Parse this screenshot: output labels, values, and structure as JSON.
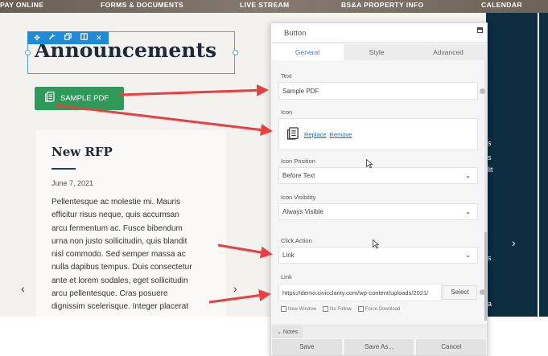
{
  "site": {
    "nav": [
      "PAY ONLINE",
      "FORMS & DOCUMENTS",
      "LIVE STREAM",
      "BS&A PROPERTY INFO",
      "CALENDAR"
    ],
    "toolbar_icons": [
      "move-icon",
      "wrench-icon",
      "copy-icon",
      "columns-icon",
      "close-icon"
    ],
    "heading": "Announcements",
    "pdf_button_label": "SAMPLE PDF",
    "card": {
      "title": "New RFP",
      "date": "June 7, 2021",
      "body_lines": [
        "Pellentesque ac molestie mi. Mauris",
        "efficitur risus neque, quis accumsan",
        "arcu fermentum ac. Fusce bibendum",
        "urna non justo sollicitudin, quis blandit",
        "nisl commodo. Sed semper massa ac",
        "nulla dapibus tempus. Duis consectetur",
        "ante et lorem sodales, eget sollicitudin",
        "arcu pellentesque. Cras posuere",
        "dignissim scelerisque. Integer placerat"
      ],
      "prev_arrow": "‹",
      "next_arrow": "›"
    },
    "dark_panel_snippets": [
      "s",
      "s",
      "lit",
      "s",
      "a"
    ],
    "dark_panel_arrow": "›"
  },
  "panel": {
    "title": "Button",
    "tabs": [
      "General",
      "Style",
      "Advanced"
    ],
    "active_tab": "General",
    "text_label": "Text",
    "text_value": "Sample PDF",
    "icon_label": "Icon",
    "icon_replace": "Replace",
    "icon_remove": "Remove",
    "icon_position_label": "Icon Position",
    "icon_position_value": "Before Text",
    "icon_visibility_label": "Icon Visibility",
    "icon_visibility_value": "Always Visible",
    "click_action_label": "Click Action",
    "click_action_value": "Link",
    "link_label": "Link",
    "link_value": "https://demo.civicclarity.com/wp-content/uploads/2021/",
    "select_label": "Select",
    "checkboxes": [
      "New Window",
      "No Follow",
      "Force Download"
    ],
    "notes_label": "Notes",
    "actions": [
      "Save",
      "Save As...",
      "Cancel"
    ]
  },
  "colors": {
    "arrow": "#e8403f",
    "pdf_button": "#2e9a5a",
    "selection": "#1f8ad8",
    "dark_panel": "#0d2d40"
  }
}
